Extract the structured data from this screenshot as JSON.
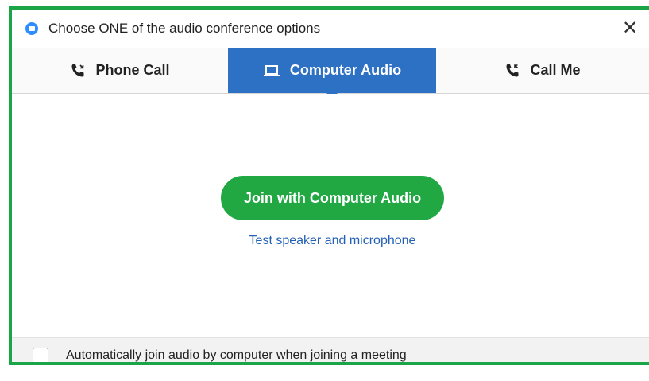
{
  "window": {
    "title": "Choose ONE of the audio conference options",
    "app_icon": "zoom-icon",
    "close_label": "✕"
  },
  "tabs": [
    {
      "label": "Phone Call",
      "icon": "phone-icon",
      "selected": false
    },
    {
      "label": "Computer Audio",
      "icon": "laptop-icon",
      "selected": true
    },
    {
      "label": "Call Me",
      "icon": "phone-callback-icon",
      "selected": false
    }
  ],
  "main": {
    "join_button_label": "Join with Computer Audio",
    "test_link_label": "Test speaker and microphone"
  },
  "footer": {
    "checkbox_label": "Automatically join audio by computer when joining a meeting",
    "checked": false
  },
  "colors": {
    "frame_border": "#1aa546",
    "selected_tab": "#2d71c5",
    "join_button": "#21a843",
    "link": "#2461b5"
  }
}
